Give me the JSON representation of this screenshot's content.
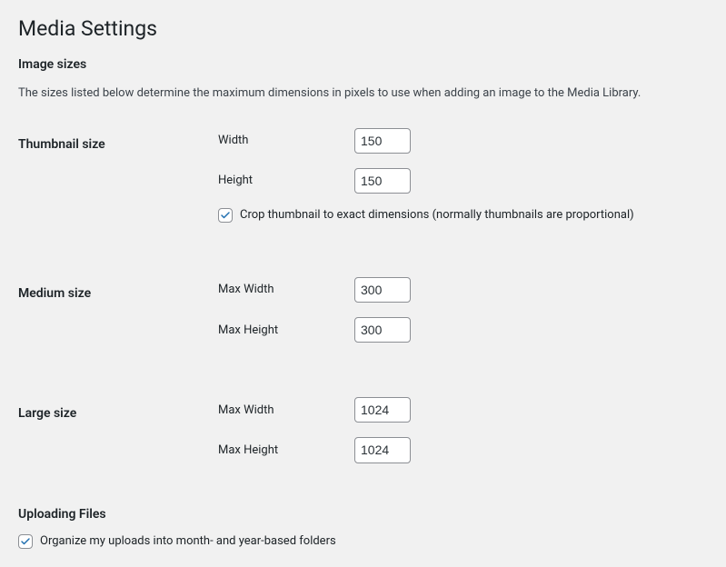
{
  "page": {
    "title": "Media Settings"
  },
  "imageSizes": {
    "heading": "Image sizes",
    "description": "The sizes listed below determine the maximum dimensions in pixels to use when adding an image to the Media Library.",
    "thumbnail": {
      "label": "Thumbnail size",
      "widthLabel": "Width",
      "width": "150",
      "heightLabel": "Height",
      "height": "150",
      "cropLabel": "Crop thumbnail to exact dimensions (normally thumbnails are proportional)",
      "cropChecked": true
    },
    "medium": {
      "label": "Medium size",
      "maxWidthLabel": "Max Width",
      "maxWidth": "300",
      "maxHeightLabel": "Max Height",
      "maxHeight": "300"
    },
    "large": {
      "label": "Large size",
      "maxWidthLabel": "Max Width",
      "maxWidth": "1024",
      "maxHeightLabel": "Max Height",
      "maxHeight": "1024"
    }
  },
  "uploading": {
    "heading": "Uploading Files",
    "organizeLabel": "Organize my uploads into month- and year-based folders",
    "organizeChecked": true
  },
  "colors": {
    "checkAccent": "#2271b1"
  }
}
